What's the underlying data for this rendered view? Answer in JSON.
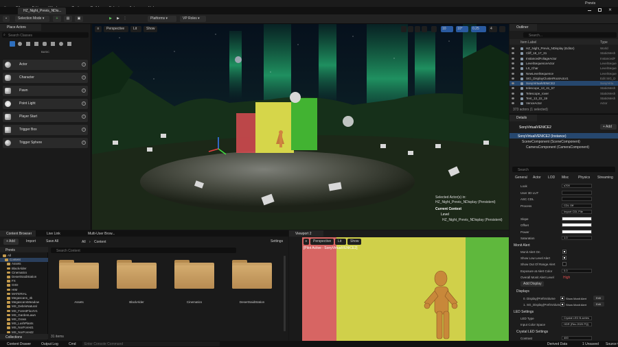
{
  "menu": [
    "File",
    "Edit",
    "Window",
    "Tools",
    "Build",
    "Select",
    "Actor",
    "Help"
  ],
  "level_tab": "HZ_Night_Previs_NDis...",
  "window_right": "Previs",
  "toolbar": {
    "mode": "Selection Mode",
    "platforms": "Platforms",
    "vp_roles": "VP Roles"
  },
  "place_actors": {
    "title": "Place Actors",
    "search_placeholder": "Search Classes",
    "category": "BASIC",
    "items": [
      "Actor",
      "Character",
      "Pawn",
      "Point Light",
      "Player Start",
      "Trigger Box",
      "Trigger Sphere"
    ]
  },
  "viewport": {
    "perspective": "Perspective",
    "lit": "Lit",
    "show": "Show",
    "snap_grid": "10",
    "snap_angle": "10°",
    "snap_scale": "0.25",
    "camera_speed": "4",
    "info_selected": "Selected Actor(s) in:",
    "info_level": "HZ_Night_Previs_NDisplay (Persistent)",
    "current_context": "Current Context",
    "level_label": "Level",
    "level_value": "HZ_Night_Previs_NDisplay (Persistent)"
  },
  "outliner": {
    "title": "Outliner",
    "search_placeholder": "Search...",
    "col_label": "Item Label",
    "col_type": "Type",
    "rows": [
      {
        "name": "HZ_Night_Previs_NDisplay (Editor)",
        "type": "World"
      },
      {
        "name": "Cliff_18_17_31",
        "type": "StaticMesh"
      },
      {
        "name": "InstancedFoliageActor",
        "type": "InstancedF"
      },
      {
        "name": "LevelSequenceActor",
        "type": "LevelSeque"
      },
      {
        "name": "LS_Char",
        "type": "LevelSeque"
      },
      {
        "name": "NewLevelSequence",
        "type": "LevelSeque"
      },
      {
        "name": "SIG_DisplayClusterRootActor1",
        "type": "Edit SIG_D"
      },
      {
        "name": "SonyVirtualVENICE2",
        "type": "SonyVirtu"
      },
      {
        "name": "telescope_13_41_57",
        "type": "StaticMesh"
      },
      {
        "name": "Telescope_rover",
        "type": "StaticMesh"
      },
      {
        "name": "Tent_13_22_19",
        "type": "StaticMesh"
      },
      {
        "name": "VenceActor",
        "type": "Actor"
      }
    ],
    "footer": "373 actors (1 selected)"
  },
  "details": {
    "title": "Details",
    "actor_name": "SonyVirtualVENICE2",
    "add_label": "+ Add",
    "component_root": "SonyVirtualVENICE2 (Instance)",
    "components": [
      "SceneComponent (SceneComponent)",
      "CameraComponent (CameraComponent)"
    ],
    "search_placeholder": "Search",
    "tabs": [
      "General",
      "Actor",
      "LOD",
      "Misc",
      "Physics",
      "Streaming"
    ],
    "props": [
      {
        "k": "Look",
        "v": "s709"
      },
      {
        "k": "User 3D LUT",
        "v": ""
      },
      {
        "k": "ASC CDL",
        "v": ""
      },
      {
        "k": "Process",
        "v": "CDL Off"
      },
      {
        "k": "",
        "v": "Import CDL File"
      },
      {
        "k": "Slope",
        "v": ""
      },
      {
        "k": "Offset",
        "v": ""
      },
      {
        "k": "Power",
        "v": ""
      },
      {
        "k": "Saturation",
        "v": "1.0"
      }
    ],
    "monit_section": "Monit Alert",
    "monit_props": [
      {
        "k": "Monit Alert On",
        "on": true
      },
      {
        "k": "Show Low Level Alert",
        "on": true
      },
      {
        "k": "Show Out Of Range Alert",
        "on": false
      }
    ],
    "exposure_label": "Exposure at Alert Color",
    "exposure_value": "0.0",
    "overall_label": "Overall Monit Alert Level",
    "overall_value": "High",
    "add_display": "Add Display",
    "displays_section": "Displays",
    "displays": [
      {
        "k": "0. Display(PrefsVolume",
        "show": "Show Monit Alert",
        "edit": "Edit"
      },
      {
        "k": "1. SG_Display(PrefsVolume",
        "show": "Show Monit Alert",
        "edit": "Edit"
      }
    ],
    "led_section": "LED Settings",
    "led_type_label": "LED Type",
    "led_type_value": "Crystal LED B-series",
    "input_color_label": "Input Color Space",
    "input_color_value": "HDR (Rec.2020 PQ)",
    "crystal_section": "Crystal LED Settings",
    "contrast_label": "Contrast",
    "contrast_value": "400"
  },
  "content_browser": {
    "tabs": [
      "Content Browser",
      "Live Link",
      "Multi-User Brow..."
    ],
    "add": "+ Add",
    "import": "Import",
    "save_all": "Save All",
    "path_all": "All",
    "path_content": "Content",
    "settings": "Settings",
    "root": "Previs",
    "search_placeholder": "Search Content",
    "tree": [
      "All",
      "Content",
      "Assets",
      "BlackAlder",
      "Cinematics",
      "DesertSaidStation",
      "FX",
      "GIGI",
      "HIM",
      "MATERIAL",
      "Megascans_4k",
      "MegascansMeadow",
      "MS_DebrisNatural",
      "MS_ForestFloorV1",
      "MS_GardenLawn",
      "MS_Grass",
      "MS_LushPlants",
      "MS_NorForest1",
      "MS_NorForest2"
    ],
    "folders": [
      "Assets",
      "BlackAlder",
      "Cinematics",
      "DesertSaidStation"
    ],
    "item_count": "31 items",
    "collections": "Collections"
  },
  "viewport2": {
    "title": "Viewport 2",
    "perspective": "Perspective",
    "lit": "Lit",
    "show": "Show",
    "pilot_label": "[Pilot Active - SonyVirtualVENICE2]"
  },
  "statusbar": {
    "content_drawer": "Content Drawer",
    "output_log": "Output Log",
    "cmd": "Cmd",
    "cmd_placeholder": "Enter Console Command",
    "derived_data": "Derived Data",
    "unsaved": "1 Unsaved",
    "source_control": "Source Control"
  }
}
